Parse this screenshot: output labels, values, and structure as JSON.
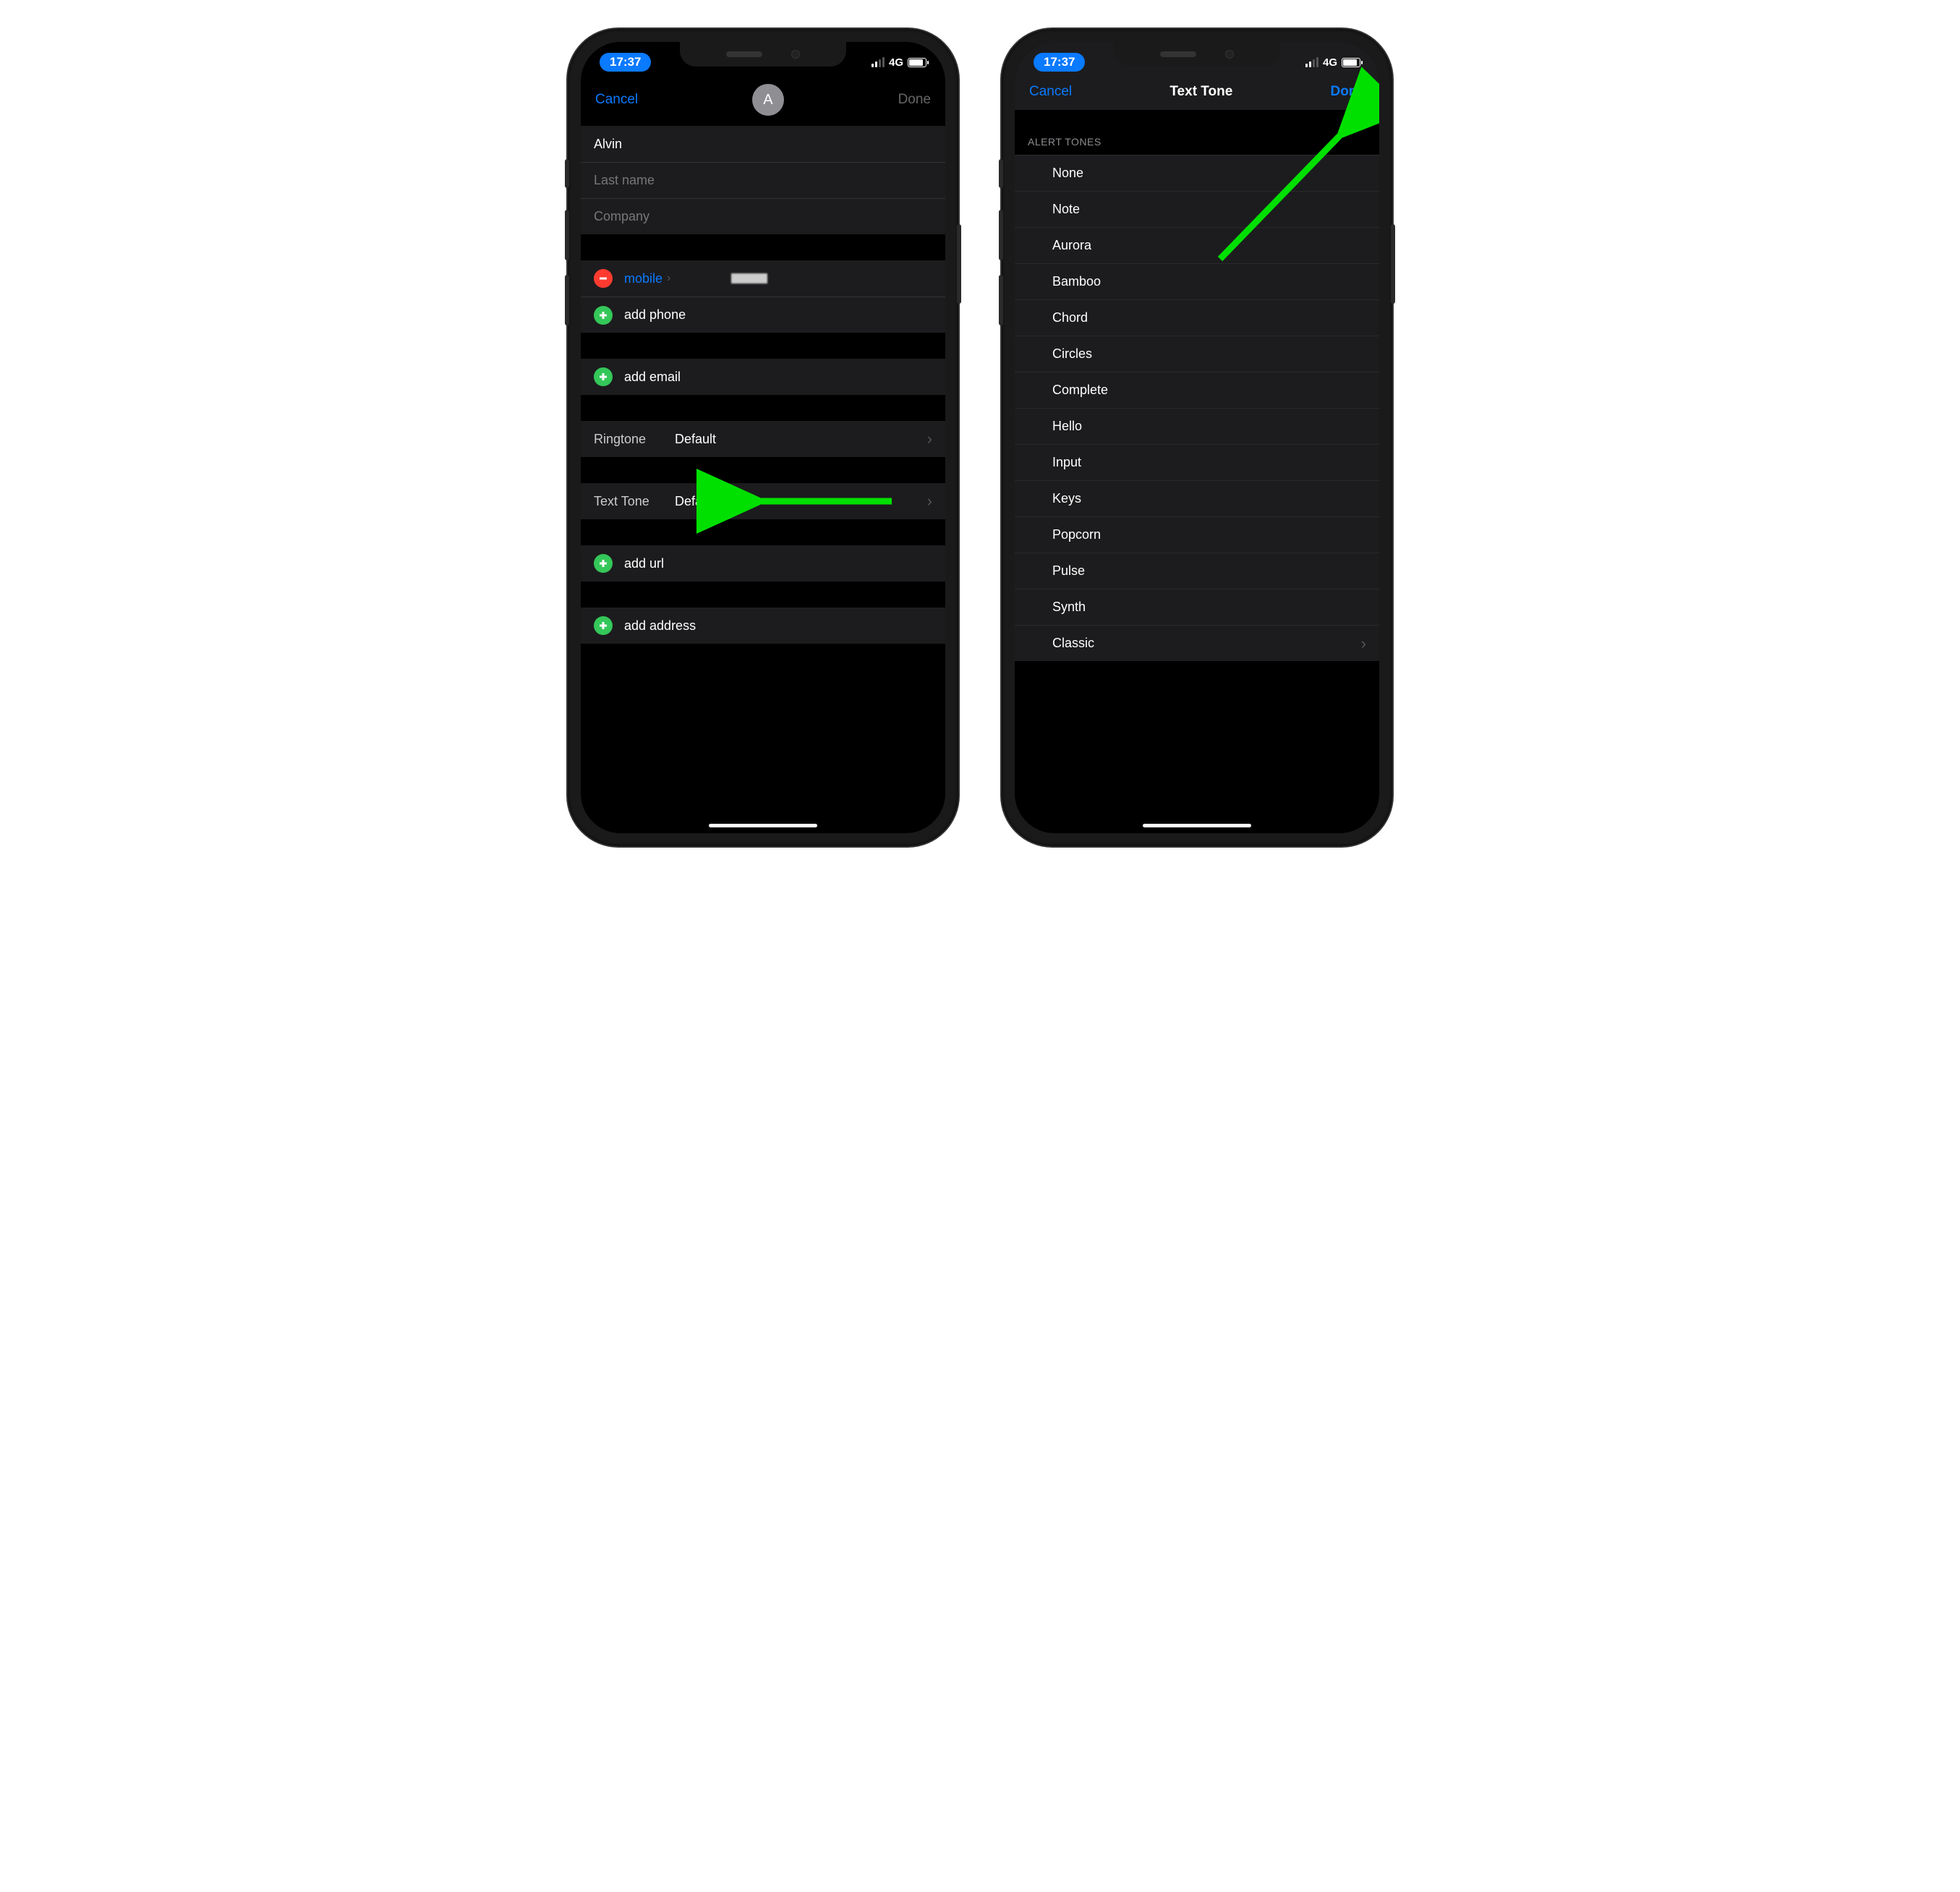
{
  "status": {
    "time": "17:37",
    "network": "4G"
  },
  "left": {
    "nav": {
      "cancel": "Cancel",
      "done": "Done",
      "avatar_initial": "A"
    },
    "name_section": {
      "first_name": "Alvin",
      "last_name_placeholder": "Last name",
      "company_placeholder": "Company"
    },
    "phone_section": {
      "type": "mobile",
      "add_phone": "add phone"
    },
    "email_section": {
      "add_email": "add email"
    },
    "ringtone": {
      "label": "Ringtone",
      "value": "Default"
    },
    "texttone": {
      "label": "Text Tone",
      "value": "Default"
    },
    "url_section": {
      "add_url": "add url"
    },
    "address_section": {
      "add_address": "add address"
    }
  },
  "right": {
    "nav": {
      "cancel": "Cancel",
      "title": "Text Tone",
      "done": "Done"
    },
    "section_header": "ALERT TONES",
    "tones": [
      "None",
      "Note",
      "Aurora",
      "Bamboo",
      "Chord",
      "Circles",
      "Complete",
      "Hello",
      "Input",
      "Keys",
      "Popcorn",
      "Pulse",
      "Synth",
      "Classic"
    ]
  },
  "colors": {
    "accent": "#0a7aff",
    "green": "#34c759",
    "red": "#ff3b30"
  }
}
